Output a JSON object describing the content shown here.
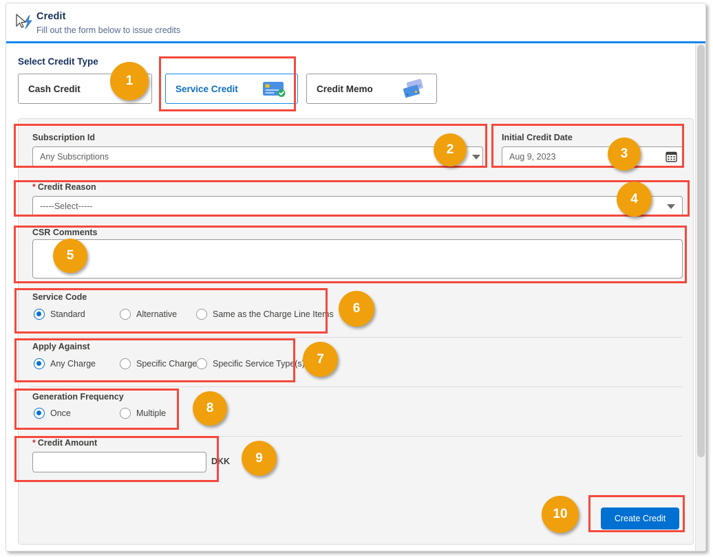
{
  "header": {
    "icon": "lightning-bolt-icon",
    "cursor": "mouse-pointer-icon",
    "title": "Credit",
    "subtitle": "Fill out the form below to issue credits",
    "accent_color": "#1589ee"
  },
  "credit_type": {
    "label": "Select Credit Type",
    "selected": "Service Credit",
    "options": [
      {
        "label": "Cash Credit",
        "icon": "cash-coin-card-icon",
        "selected": false
      },
      {
        "label": "Service Credit",
        "icon": "credit-card-check-icon",
        "selected": true
      },
      {
        "label": "Credit Memo",
        "icon": "two-credit-cards-icon",
        "selected": false
      }
    ]
  },
  "form": {
    "subscription": {
      "label": "Subscription Id",
      "value": "Any Subscriptions",
      "icon": "chevron-down-icon"
    },
    "initial_credit_date": {
      "label": "Initial Credit Date",
      "value": "Aug 9, 2023",
      "icon": "calendar-icon"
    },
    "credit_reason": {
      "label": "Credit Reason",
      "required": true,
      "required_marker": "*",
      "value": "-----Select-----",
      "icon": "chevron-down-icon"
    },
    "csr_comments": {
      "label": "CSR Comments",
      "value": ""
    },
    "service_code": {
      "label": "Service Code",
      "selected": "Standard",
      "options": [
        {
          "label": "Standard",
          "selected": true
        },
        {
          "label": "Alternative",
          "selected": false
        },
        {
          "label": "Same as the Charge Line Items",
          "selected": false
        }
      ]
    },
    "apply_against": {
      "label": "Apply Against",
      "selected": "Any Charge",
      "options": [
        {
          "label": "Any Charge",
          "selected": true
        },
        {
          "label": "Specific Charge",
          "selected": false
        },
        {
          "label": "Specific Service Type(s)",
          "selected": false
        }
      ]
    },
    "generation_frequency": {
      "label": "Generation Frequency",
      "selected": "Once",
      "options": [
        {
          "label": "Once",
          "selected": true
        },
        {
          "label": "Multiple",
          "selected": false
        }
      ]
    },
    "credit_amount": {
      "label": "Credit Amount",
      "required": true,
      "required_marker": "*",
      "value": "",
      "currency": "DKK"
    }
  },
  "footer": {
    "submit_label": "Create Credit",
    "submit_color": "#0070d2"
  },
  "annotations": {
    "color": "#f4493c",
    "badge_color": "#f0a00c",
    "badges": [
      {
        "n": "1",
        "target": "credit-type-service-credit"
      },
      {
        "n": "2",
        "target": "subscription-id-field"
      },
      {
        "n": "3",
        "target": "initial-credit-date-field"
      },
      {
        "n": "4",
        "target": "credit-reason-field"
      },
      {
        "n": "5",
        "target": "csr-comments-field"
      },
      {
        "n": "6",
        "target": "service-code-group"
      },
      {
        "n": "7",
        "target": "apply-against-group"
      },
      {
        "n": "8",
        "target": "generation-frequency-group"
      },
      {
        "n": "9",
        "target": "credit-amount-field"
      },
      {
        "n": "10",
        "target": "create-credit-button"
      }
    ]
  }
}
